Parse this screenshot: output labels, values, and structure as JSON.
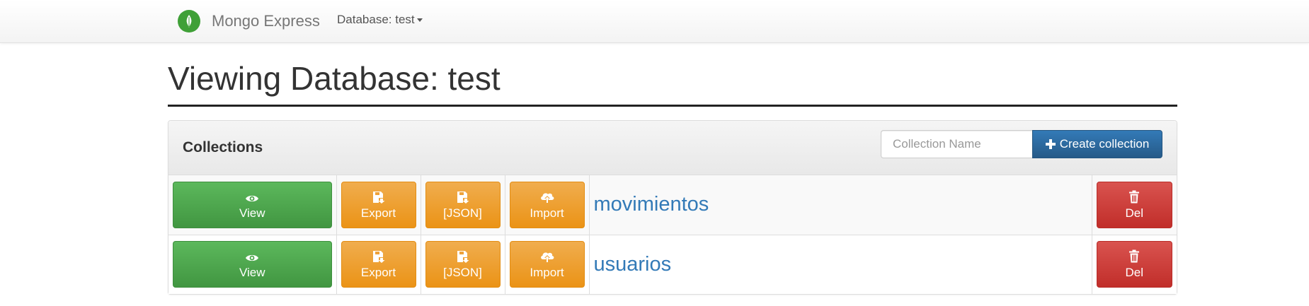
{
  "navbar": {
    "brand_name": "Mongo Express",
    "database_dropdown": "Database: test"
  },
  "page": {
    "title": "Viewing Database: test"
  },
  "panel": {
    "title": "Collections",
    "create_input_placeholder": "Collection Name",
    "create_button_label": "Create collection"
  },
  "collections": [
    {
      "name": "movimientos",
      "view_label": "View",
      "export_label": "Export",
      "json_label": "[JSON]",
      "import_label": "Import",
      "del_label": "Del"
    },
    {
      "name": "usuarios",
      "view_label": "View",
      "export_label": "Export",
      "json_label": "[JSON]",
      "import_label": "Import",
      "del_label": "Del"
    }
  ],
  "colors": {
    "primary": "#337ab7",
    "success": "#5cb85c",
    "warning": "#f0ad4e",
    "danger": "#d9534f",
    "brand_logo": "#3fa037"
  },
  "icons": {
    "brand": "mongodb-leaf-icon",
    "create": "plus-icon",
    "view": "eye-icon",
    "export": "floppy-save-icon",
    "json": "floppy-save-icon",
    "import": "cloud-upload-icon",
    "delete": "trash-icon"
  }
}
